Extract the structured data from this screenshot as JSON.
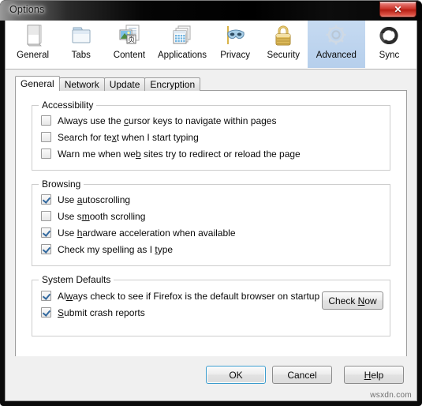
{
  "window": {
    "title": "Options",
    "close_label": "✕",
    "close_icon": "close-icon",
    "watermark": "wsxdn.com"
  },
  "toolbar": {
    "items": [
      {
        "label": "General",
        "icon": "document-page-icon",
        "selected": false
      },
      {
        "label": "Tabs",
        "icon": "folder-tabs-icon",
        "selected": false
      },
      {
        "label": "Content",
        "icon": "content-image-icon",
        "selected": false
      },
      {
        "label": "Applications",
        "icon": "applications-icon",
        "selected": false
      },
      {
        "label": "Privacy",
        "icon": "privacy-mask-icon",
        "selected": false
      },
      {
        "label": "Security",
        "icon": "security-padlock-icon",
        "selected": false
      },
      {
        "label": "Advanced",
        "icon": "advanced-gear-icon",
        "selected": true
      },
      {
        "label": "Sync",
        "icon": "sync-arrows-icon",
        "selected": false
      }
    ],
    "selected_accent": "#b6cfec"
  },
  "tabs": [
    {
      "label": "General",
      "active": true
    },
    {
      "label": "Network",
      "active": false
    },
    {
      "label": "Update",
      "active": false
    },
    {
      "label": "Encryption",
      "active": false
    }
  ],
  "groups": {
    "accessibility": {
      "title": "Accessibility",
      "options": [
        {
          "pre": "Always use the ",
          "key": "c",
          "post": "ursor keys to navigate within pages",
          "checked": false
        },
        {
          "pre": "Search for te",
          "key": "x",
          "post": "t when I start typing",
          "checked": false
        },
        {
          "pre": "Warn me when we",
          "key": "b",
          "post": " sites try to redirect or reload the page",
          "checked": false
        }
      ]
    },
    "browsing": {
      "title": "Browsing",
      "options": [
        {
          "pre": "Use ",
          "key": "a",
          "post": "utoscrolling",
          "checked": true
        },
        {
          "pre": "Use s",
          "key": "m",
          "post": "ooth scrolling",
          "checked": false
        },
        {
          "pre": "Use ",
          "key": "h",
          "post": "ardware acceleration when available",
          "checked": true
        },
        {
          "pre": "Check my spelling as I ",
          "key": "t",
          "post": "ype",
          "checked": true
        }
      ]
    },
    "system_defaults": {
      "title": "System Defaults",
      "options": [
        {
          "pre": "Al",
          "key": "w",
          "post": "ays check to see if Firefox is the default browser on startup",
          "checked": true
        },
        {
          "pre": "",
          "key": "S",
          "post": "ubmit crash reports",
          "checked": true
        }
      ],
      "check_now": {
        "pre": "Check ",
        "key": "N",
        "post": "ow"
      }
    }
  },
  "footer": {
    "buttons": [
      {
        "pre": "OK",
        "key": "",
        "post": "",
        "name": "ok-button",
        "default": true
      },
      {
        "pre": "Cancel",
        "key": "",
        "post": "",
        "name": "cancel-button",
        "default": false
      },
      {
        "pre": "",
        "key": "H",
        "post": "elp",
        "name": "help-button",
        "default": false
      }
    ]
  }
}
